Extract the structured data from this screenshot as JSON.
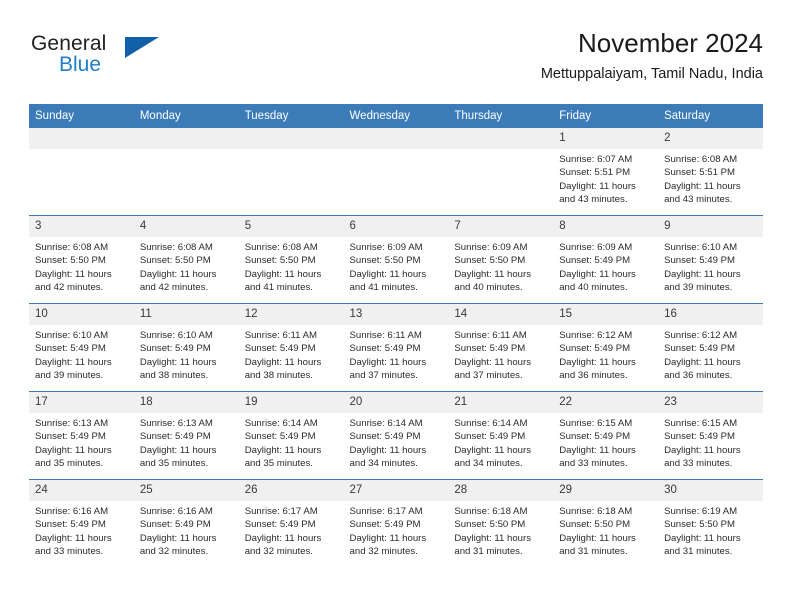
{
  "brand": {
    "name_part1": "General",
    "name_part2": "Blue",
    "accent_color": "#1260a8",
    "text_color": "#1f7ec4"
  },
  "header": {
    "title": "November 2024",
    "subtitle": "Mettuppalaiyam, Tamil Nadu, India"
  },
  "theme": {
    "header_bg": "#3b7cb8",
    "daynum_bg": "#f0f0f0",
    "cell_border": "#3b7cb8"
  },
  "weekdays": [
    "Sunday",
    "Monday",
    "Tuesday",
    "Wednesday",
    "Thursday",
    "Friday",
    "Saturday"
  ],
  "labels": {
    "sunrise_prefix": "Sunrise:",
    "sunset_prefix": "Sunset:",
    "daylight_prefix": "Daylight:"
  },
  "weeks": [
    [
      {
        "day": "",
        "empty": true
      },
      {
        "day": "",
        "empty": true
      },
      {
        "day": "",
        "empty": true
      },
      {
        "day": "",
        "empty": true
      },
      {
        "day": "",
        "empty": true
      },
      {
        "day": "1",
        "sunrise": "Sunrise: 6:07 AM",
        "sunset": "Sunset: 5:51 PM",
        "daylight": "Daylight: 11 hours and 43 minutes."
      },
      {
        "day": "2",
        "sunrise": "Sunrise: 6:08 AM",
        "sunset": "Sunset: 5:51 PM",
        "daylight": "Daylight: 11 hours and 43 minutes."
      }
    ],
    [
      {
        "day": "3",
        "sunrise": "Sunrise: 6:08 AM",
        "sunset": "Sunset: 5:50 PM",
        "daylight": "Daylight: 11 hours and 42 minutes."
      },
      {
        "day": "4",
        "sunrise": "Sunrise: 6:08 AM",
        "sunset": "Sunset: 5:50 PM",
        "daylight": "Daylight: 11 hours and 42 minutes."
      },
      {
        "day": "5",
        "sunrise": "Sunrise: 6:08 AM",
        "sunset": "Sunset: 5:50 PM",
        "daylight": "Daylight: 11 hours and 41 minutes."
      },
      {
        "day": "6",
        "sunrise": "Sunrise: 6:09 AM",
        "sunset": "Sunset: 5:50 PM",
        "daylight": "Daylight: 11 hours and 41 minutes."
      },
      {
        "day": "7",
        "sunrise": "Sunrise: 6:09 AM",
        "sunset": "Sunset: 5:50 PM",
        "daylight": "Daylight: 11 hours and 40 minutes."
      },
      {
        "day": "8",
        "sunrise": "Sunrise: 6:09 AM",
        "sunset": "Sunset: 5:49 PM",
        "daylight": "Daylight: 11 hours and 40 minutes."
      },
      {
        "day": "9",
        "sunrise": "Sunrise: 6:10 AM",
        "sunset": "Sunset: 5:49 PM",
        "daylight": "Daylight: 11 hours and 39 minutes."
      }
    ],
    [
      {
        "day": "10",
        "sunrise": "Sunrise: 6:10 AM",
        "sunset": "Sunset: 5:49 PM",
        "daylight": "Daylight: 11 hours and 39 minutes."
      },
      {
        "day": "11",
        "sunrise": "Sunrise: 6:10 AM",
        "sunset": "Sunset: 5:49 PM",
        "daylight": "Daylight: 11 hours and 38 minutes."
      },
      {
        "day": "12",
        "sunrise": "Sunrise: 6:11 AM",
        "sunset": "Sunset: 5:49 PM",
        "daylight": "Daylight: 11 hours and 38 minutes."
      },
      {
        "day": "13",
        "sunrise": "Sunrise: 6:11 AM",
        "sunset": "Sunset: 5:49 PM",
        "daylight": "Daylight: 11 hours and 37 minutes."
      },
      {
        "day": "14",
        "sunrise": "Sunrise: 6:11 AM",
        "sunset": "Sunset: 5:49 PM",
        "daylight": "Daylight: 11 hours and 37 minutes."
      },
      {
        "day": "15",
        "sunrise": "Sunrise: 6:12 AM",
        "sunset": "Sunset: 5:49 PM",
        "daylight": "Daylight: 11 hours and 36 minutes."
      },
      {
        "day": "16",
        "sunrise": "Sunrise: 6:12 AM",
        "sunset": "Sunset: 5:49 PM",
        "daylight": "Daylight: 11 hours and 36 minutes."
      }
    ],
    [
      {
        "day": "17",
        "sunrise": "Sunrise: 6:13 AM",
        "sunset": "Sunset: 5:49 PM",
        "daylight": "Daylight: 11 hours and 35 minutes."
      },
      {
        "day": "18",
        "sunrise": "Sunrise: 6:13 AM",
        "sunset": "Sunset: 5:49 PM",
        "daylight": "Daylight: 11 hours and 35 minutes."
      },
      {
        "day": "19",
        "sunrise": "Sunrise: 6:14 AM",
        "sunset": "Sunset: 5:49 PM",
        "daylight": "Daylight: 11 hours and 35 minutes."
      },
      {
        "day": "20",
        "sunrise": "Sunrise: 6:14 AM",
        "sunset": "Sunset: 5:49 PM",
        "daylight": "Daylight: 11 hours and 34 minutes."
      },
      {
        "day": "21",
        "sunrise": "Sunrise: 6:14 AM",
        "sunset": "Sunset: 5:49 PM",
        "daylight": "Daylight: 11 hours and 34 minutes."
      },
      {
        "day": "22",
        "sunrise": "Sunrise: 6:15 AM",
        "sunset": "Sunset: 5:49 PM",
        "daylight": "Daylight: 11 hours and 33 minutes."
      },
      {
        "day": "23",
        "sunrise": "Sunrise: 6:15 AM",
        "sunset": "Sunset: 5:49 PM",
        "daylight": "Daylight: 11 hours and 33 minutes."
      }
    ],
    [
      {
        "day": "24",
        "sunrise": "Sunrise: 6:16 AM",
        "sunset": "Sunset: 5:49 PM",
        "daylight": "Daylight: 11 hours and 33 minutes."
      },
      {
        "day": "25",
        "sunrise": "Sunrise: 6:16 AM",
        "sunset": "Sunset: 5:49 PM",
        "daylight": "Daylight: 11 hours and 32 minutes."
      },
      {
        "day": "26",
        "sunrise": "Sunrise: 6:17 AM",
        "sunset": "Sunset: 5:49 PM",
        "daylight": "Daylight: 11 hours and 32 minutes."
      },
      {
        "day": "27",
        "sunrise": "Sunrise: 6:17 AM",
        "sunset": "Sunset: 5:49 PM",
        "daylight": "Daylight: 11 hours and 32 minutes."
      },
      {
        "day": "28",
        "sunrise": "Sunrise: 6:18 AM",
        "sunset": "Sunset: 5:50 PM",
        "daylight": "Daylight: 11 hours and 31 minutes."
      },
      {
        "day": "29",
        "sunrise": "Sunrise: 6:18 AM",
        "sunset": "Sunset: 5:50 PM",
        "daylight": "Daylight: 11 hours and 31 minutes."
      },
      {
        "day": "30",
        "sunrise": "Sunrise: 6:19 AM",
        "sunset": "Sunset: 5:50 PM",
        "daylight": "Daylight: 11 hours and 31 minutes."
      }
    ]
  ]
}
